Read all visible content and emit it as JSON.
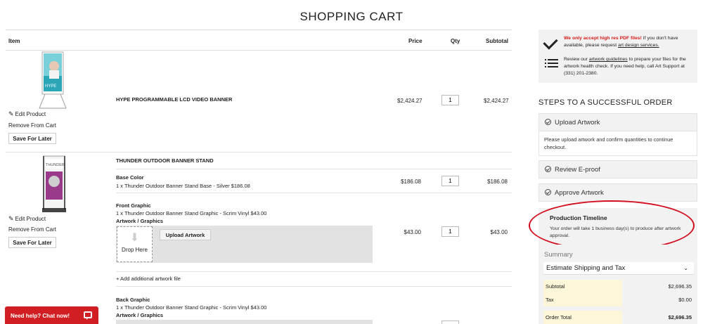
{
  "page": {
    "title": "SHOPPING CART"
  },
  "cart": {
    "headers": {
      "item": "Item",
      "price": "Price",
      "qty": "Qty",
      "subtotal": "Subtotal"
    },
    "items": [
      {
        "name": "HYPE PROGRAMMABLE LCD VIDEO BANNER",
        "price": "$2,424.27",
        "qty": "1",
        "subtotal": "$2,424.27",
        "edit_label": "Edit Product",
        "remove_label": "Remove From Cart",
        "save_label": "Save For Later"
      },
      {
        "name": "THUNDER OUTDOOR BANNER STAND",
        "edit_label": "Edit Product",
        "remove_label": "Remove From Cart",
        "save_label": "Save For Later",
        "options": [
          {
            "label": "Base Color",
            "desc": "1 x Thunder Outdoor Banner Stand Base - Silver $186.08",
            "price": "$186.08",
            "qty": "1",
            "subtotal": "$186.08"
          },
          {
            "label": "Front Graphic",
            "desc": "1 x Thunder Outdoor Banner Stand Graphic - Scrim Vinyl $43.00",
            "artwork_label": "Artwork / Graphics",
            "drop_label": "Drop Here",
            "upload_label": "Upload Artwork",
            "price": "$43.00",
            "qty": "1",
            "subtotal": "$43.00",
            "add_file_label": "+ Add additional artwork file"
          },
          {
            "label": "Back Graphic",
            "desc": "1 x Thunder Outdoor Banner Stand Graphic - Scrim Vinyl $43.00",
            "artwork_label": "Artwork / Graphics"
          }
        ]
      }
    ]
  },
  "notice": {
    "red_text": "We only accept high res PDF files!",
    "text1": " If you don't have available, please request ",
    "link1": "art design services.",
    "text2a": "Review our ",
    "link2": "artwork guidelines",
    "text2b": " to prepare your files for the artwork health check. If you need help, call Art Support at (331) 201-2380."
  },
  "steps": {
    "title": "STEPS TO A SUCCESSFUL ORDER",
    "items": [
      {
        "label": "Upload Artwork",
        "body": "Please upload artwork and confirm quantities to continue checkout."
      },
      {
        "label": "Review E-proof"
      },
      {
        "label": "Approve Artwork"
      }
    ]
  },
  "timeline": {
    "title": "Production Timeline",
    "text": "Your order will take 1 business day(s) to produce after artwork approval."
  },
  "summary": {
    "title": "Summary",
    "shipping_label": "Estimate Shipping and Tax",
    "rows": [
      {
        "label": "Subtotal",
        "value": "$2,696.35"
      },
      {
        "label": "Tax",
        "value": "$0.00"
      },
      {
        "label": "Order Total",
        "value": "$2,696.35"
      }
    ]
  },
  "chat": {
    "label": "Need help? Chat now!"
  },
  "colors": {
    "accent_red": "#d01e22",
    "highlight_yellow": "#fdf6d8",
    "panel_gray": "#f2f2f2"
  }
}
